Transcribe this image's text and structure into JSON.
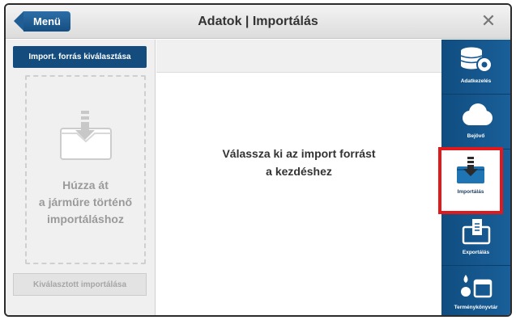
{
  "header": {
    "menu_label": "Menü",
    "title": "Adatok | Importálás",
    "close_symbol": "✕"
  },
  "left_panel": {
    "import_source_label": "Import. forrás kiválasztása",
    "drop_zone_lines": [
      "Húzza át",
      "a járműre történő",
      "importáláshoz"
    ],
    "drop_icon": "import-tray-icon",
    "selected_import_label": "Kiválasztott importálása"
  },
  "main": {
    "message_lines": [
      "Válassza ki az import forrást",
      "a kezdéshez"
    ]
  },
  "sidebar": {
    "items": [
      {
        "label": "Adatkezelés",
        "icon": "database-gear-icon",
        "active": false
      },
      {
        "label": "Bejövő",
        "icon": "cloud-icon",
        "active": false
      },
      {
        "label": "Importálás",
        "icon": "import-tray-icon",
        "active": true
      },
      {
        "label": "Exportálás",
        "icon": "export-tray-icon",
        "active": false
      },
      {
        "label": "Terménykönyvtár",
        "icon": "crop-library-icon",
        "active": false
      }
    ]
  },
  "colors": {
    "accent": "#134c7d",
    "sidebar": "#15578e",
    "highlight": "#e0191c"
  }
}
